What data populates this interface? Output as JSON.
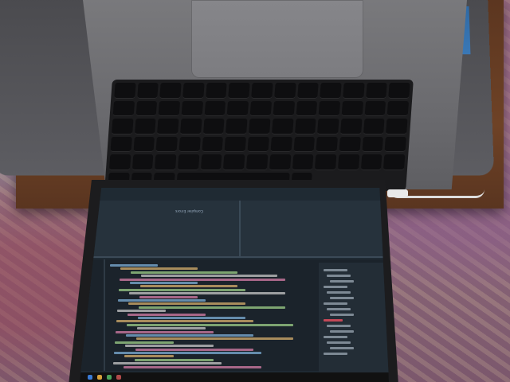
{
  "scene": {
    "surface": "rug",
    "table": "wooden",
    "device": "laptop"
  },
  "editor": {
    "top_hint": "Compiler Errors"
  }
}
